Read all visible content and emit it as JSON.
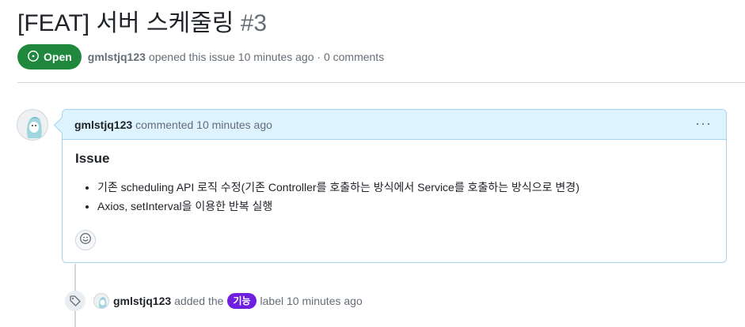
{
  "issue": {
    "title": "[FEAT] 서버 스케줄링",
    "number": "#3",
    "state": "Open",
    "state_color": "#1f883d",
    "author": "gmlstjq123",
    "opened_text": "opened this issue 10 minutes ago · 0 comments"
  },
  "comment": {
    "author": "gmlstjq123",
    "action_text": "commented 10 minutes ago",
    "menu_icon": "kebab-horizontal-icon",
    "heading": "Issue",
    "items": [
      "기존 scheduling API 로직 수정(기존 Controller를 호출하는 방식에서 Service를 호출하는 방식으로 변경)",
      "Axios, setInterval을 이용한 반복 실행"
    ],
    "reaction_icon": "smiley-icon"
  },
  "event": {
    "icon": "tag-icon",
    "author": "gmlstjq123",
    "text_before": "added the",
    "label": "기능",
    "label_color": "#6f1fe0",
    "text_after": "label 10 minutes ago"
  }
}
